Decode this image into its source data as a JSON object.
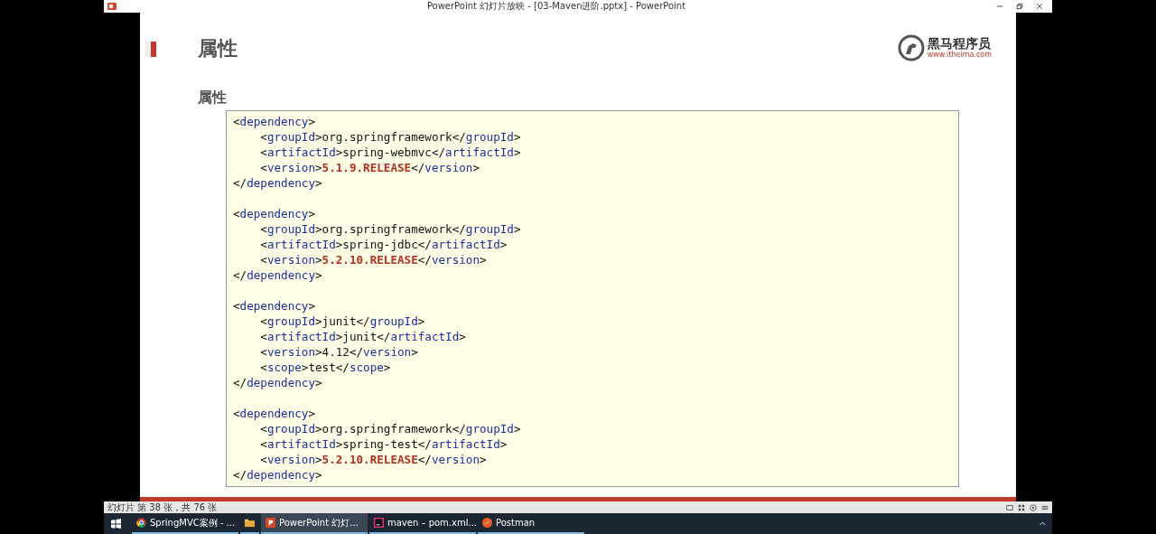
{
  "window": {
    "title": "PowerPoint 幻灯片放映 - [03-Maven进阶.pptx] - PowerPoint"
  },
  "slide": {
    "title": "属性",
    "logo": {
      "name": "黑马程序员",
      "url": "www.itheima.com"
    },
    "subtitle": "属性",
    "code_blocks": [
      [
        [
          {
            "kind": "p",
            "text": "<"
          },
          {
            "kind": "t",
            "text": "dependency"
          },
          {
            "kind": "p",
            "text": ">"
          }
        ],
        [
          {
            "kind": "p",
            "text": "    <"
          },
          {
            "kind": "t",
            "text": "groupId"
          },
          {
            "kind": "p",
            "text": ">org.springframework</"
          },
          {
            "kind": "t",
            "text": "groupId"
          },
          {
            "kind": "p",
            "text": ">"
          }
        ],
        [
          {
            "kind": "p",
            "text": "    <"
          },
          {
            "kind": "t",
            "text": "artifactId"
          },
          {
            "kind": "p",
            "text": ">spring-webmvc</"
          },
          {
            "kind": "t",
            "text": "artifactId"
          },
          {
            "kind": "p",
            "text": ">"
          }
        ],
        [
          {
            "kind": "p",
            "text": "    <"
          },
          {
            "kind": "t",
            "text": "version"
          },
          {
            "kind": "p",
            "text": ">"
          },
          {
            "kind": "v",
            "text": "5.1.9.RELEASE"
          },
          {
            "kind": "p",
            "text": "</"
          },
          {
            "kind": "t",
            "text": "version"
          },
          {
            "kind": "p",
            "text": ">"
          }
        ],
        [
          {
            "kind": "p",
            "text": "</"
          },
          {
            "kind": "t",
            "text": "dependency"
          },
          {
            "kind": "p",
            "text": ">"
          }
        ]
      ],
      [
        [
          {
            "kind": "p",
            "text": "<"
          },
          {
            "kind": "t",
            "text": "dependency"
          },
          {
            "kind": "p",
            "text": ">"
          }
        ],
        [
          {
            "kind": "p",
            "text": "    <"
          },
          {
            "kind": "t",
            "text": "groupId"
          },
          {
            "kind": "p",
            "text": ">org.springframework</"
          },
          {
            "kind": "t",
            "text": "groupId"
          },
          {
            "kind": "p",
            "text": ">"
          }
        ],
        [
          {
            "kind": "p",
            "text": "    <"
          },
          {
            "kind": "t",
            "text": "artifactId"
          },
          {
            "kind": "p",
            "text": ">spring-jdbc</"
          },
          {
            "kind": "t",
            "text": "artifactId"
          },
          {
            "kind": "p",
            "text": ">"
          }
        ],
        [
          {
            "kind": "p",
            "text": "    <"
          },
          {
            "kind": "t",
            "text": "version"
          },
          {
            "kind": "p",
            "text": ">"
          },
          {
            "kind": "v",
            "text": "5.2.10.RELEASE"
          },
          {
            "kind": "p",
            "text": "</"
          },
          {
            "kind": "t",
            "text": "version"
          },
          {
            "kind": "p",
            "text": ">"
          }
        ],
        [
          {
            "kind": "p",
            "text": "</"
          },
          {
            "kind": "t",
            "text": "dependency"
          },
          {
            "kind": "p",
            "text": ">"
          }
        ]
      ],
      [
        [
          {
            "kind": "p",
            "text": "<"
          },
          {
            "kind": "t",
            "text": "dependency"
          },
          {
            "kind": "p",
            "text": ">"
          }
        ],
        [
          {
            "kind": "p",
            "text": "    <"
          },
          {
            "kind": "t",
            "text": "groupId"
          },
          {
            "kind": "p",
            "text": ">junit</"
          },
          {
            "kind": "t",
            "text": "groupId"
          },
          {
            "kind": "p",
            "text": ">"
          }
        ],
        [
          {
            "kind": "p",
            "text": "    <"
          },
          {
            "kind": "t",
            "text": "artifactId"
          },
          {
            "kind": "p",
            "text": ">junit</"
          },
          {
            "kind": "t",
            "text": "artifactId"
          },
          {
            "kind": "p",
            "text": ">"
          }
        ],
        [
          {
            "kind": "p",
            "text": "    <"
          },
          {
            "kind": "t",
            "text": "version"
          },
          {
            "kind": "p",
            "text": ">4.12</"
          },
          {
            "kind": "t",
            "text": "version"
          },
          {
            "kind": "p",
            "text": ">"
          }
        ],
        [
          {
            "kind": "p",
            "text": "    <"
          },
          {
            "kind": "t",
            "text": "scope"
          },
          {
            "kind": "p",
            "text": ">test</"
          },
          {
            "kind": "t",
            "text": "scope"
          },
          {
            "kind": "p",
            "text": ">"
          }
        ],
        [
          {
            "kind": "p",
            "text": "</"
          },
          {
            "kind": "t",
            "text": "dependency"
          },
          {
            "kind": "p",
            "text": ">"
          }
        ]
      ],
      [
        [
          {
            "kind": "p",
            "text": "<"
          },
          {
            "kind": "t",
            "text": "dependency"
          },
          {
            "kind": "p",
            "text": ">"
          }
        ],
        [
          {
            "kind": "p",
            "text": "    <"
          },
          {
            "kind": "t",
            "text": "groupId"
          },
          {
            "kind": "p",
            "text": ">org.springframework</"
          },
          {
            "kind": "t",
            "text": "groupId"
          },
          {
            "kind": "p",
            "text": ">"
          }
        ],
        [
          {
            "kind": "p",
            "text": "    <"
          },
          {
            "kind": "t",
            "text": "artifactId"
          },
          {
            "kind": "p",
            "text": ">spring-test</"
          },
          {
            "kind": "t",
            "text": "artifactId"
          },
          {
            "kind": "p",
            "text": ">"
          }
        ],
        [
          {
            "kind": "p",
            "text": "    <"
          },
          {
            "kind": "t",
            "text": "version"
          },
          {
            "kind": "p",
            "text": ">"
          },
          {
            "kind": "v",
            "text": "5.2.10.RELEASE"
          },
          {
            "kind": "p",
            "text": "</"
          },
          {
            "kind": "t",
            "text": "version"
          },
          {
            "kind": "p",
            "text": ">"
          }
        ],
        [
          {
            "kind": "p",
            "text": "</"
          },
          {
            "kind": "t",
            "text": "dependency"
          },
          {
            "kind": "p",
            "text": ">"
          }
        ]
      ]
    ]
  },
  "status_bar": {
    "text": "幻灯片 第 38 张，共 76 张"
  },
  "taskbar": {
    "items": [
      {
        "kind": "chrome",
        "label": "SpringMVC案例 - ...",
        "selected": false
      },
      {
        "kind": "folder",
        "selected": false
      },
      {
        "kind": "powerpoint",
        "label": "PowerPoint 幻灯...",
        "selected": true
      },
      {
        "kind": "idea",
        "label": "maven – pom.xml...",
        "selected": false
      },
      {
        "kind": "postman",
        "label": "Postman",
        "selected": false
      }
    ]
  }
}
